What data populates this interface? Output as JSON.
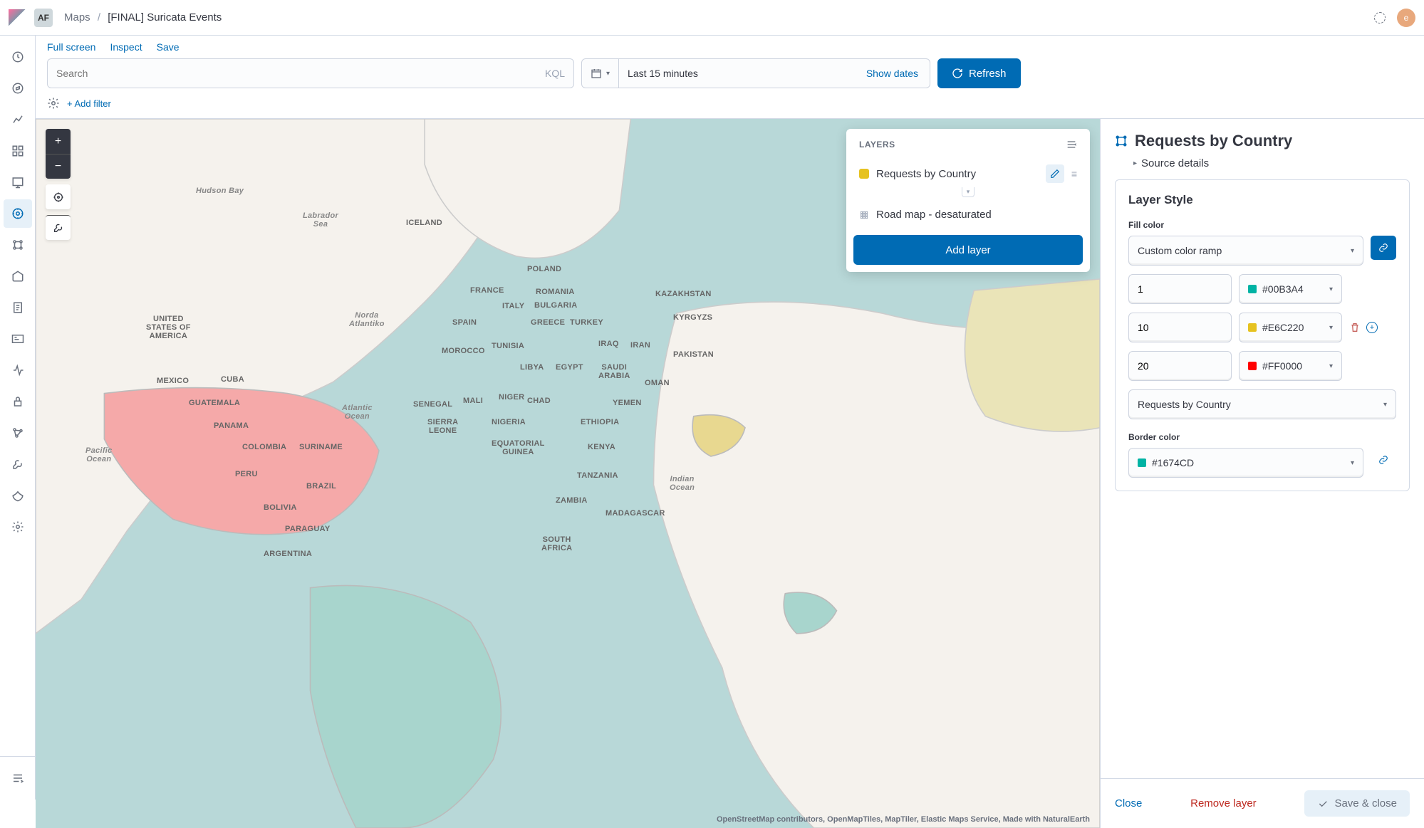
{
  "topbar": {
    "space": "AF",
    "breadcrumb_app": "Maps",
    "breadcrumb_title": "[FINAL] Suricata Events",
    "avatar": "e"
  },
  "actions": {
    "fullscreen": "Full screen",
    "inspect": "Inspect",
    "save": "Save"
  },
  "search": {
    "placeholder": "Search",
    "kql": "KQL",
    "daterange": "Last 15 minutes",
    "show_dates": "Show dates",
    "refresh": "Refresh"
  },
  "filter": {
    "add": "+ Add filter"
  },
  "layers": {
    "title": "LAYERS",
    "items": [
      {
        "name": "Requests by Country"
      },
      {
        "name": "Road map - desaturated"
      }
    ],
    "add_layer": "Add layer"
  },
  "map": {
    "attribution": "OpenStreetMap contributors, OpenMapTiles, MapTiler, Elastic Maps Service, Made with NaturalEarth",
    "labels": {
      "iceland": "ICELAND",
      "usa": "UNITED\nSTATES OF\nAMERICA",
      "mexico": "MEXICO",
      "cuba": "CUBA",
      "guatemala": "GUATEMALA",
      "panama": "PANAMA",
      "colombia": "COLOMBIA",
      "peru": "PERU",
      "bolivia": "BOLIVIA",
      "brazil": "BRAZIL",
      "paraguay": "PARAGUAY",
      "argentina": "ARGENTINA",
      "suriname": "SURINAME",
      "pacific": "Pacific\nOcean",
      "atlantic": "Atlantic\nOcean",
      "hudson": "Hudson Bay",
      "labrador": "Labrador\nSea",
      "norda": "Norda\nAtlantiko",
      "france": "FRANCE",
      "spain": "SPAIN",
      "italy": "ITALY",
      "greece": "GREECE",
      "turkey": "TURKEY",
      "romania": "ROMANIA",
      "bulgaria": "BULGARIA",
      "poland": "POLAND",
      "morocco": "MOROCCO",
      "tunisia": "TUNISIA",
      "libya": "LIBYA",
      "egypt": "EGYPT",
      "saudi": "SAUDI\nARABIA",
      "iraq": "IRAQ",
      "iran": "IRAN",
      "pakistan": "PAKISTAN",
      "kazakhstan": "KAZAKHSTAN",
      "kyrgyzstan": "KYRGYZS",
      "oman": "OMAN",
      "yemen": "YEMEN",
      "senegal": "SENEGAL",
      "sierra": "SIERRA\nLEONE",
      "mali": "MALI",
      "niger": "NIGER",
      "chad": "CHAD",
      "nigeria": "NIGERIA",
      "ethiopia": "ETHIOPIA",
      "kenya": "KENYA",
      "tanzania": "TANZANIA",
      "zambia": "ZAMBIA",
      "madagascar": "MADAGASCAR",
      "south_africa": "SOUTH\nAFRICA",
      "eq_guinea": "EQUATORIAL\nGUINEA",
      "indian": "Indian\nOcean"
    }
  },
  "settings": {
    "title": "Requests by Country",
    "source_details": "Source details",
    "style_title": "Layer Style",
    "fill_label": "Fill color",
    "ramp_mode": "Custom color ramp",
    "stops": [
      {
        "value": "1",
        "hex": "#00B3A4",
        "color": "#00b3a4"
      },
      {
        "value": "10",
        "hex": "#E6C220",
        "color": "#e6c220"
      },
      {
        "value": "20",
        "hex": "#FF0000",
        "color": "#ff0000"
      }
    ],
    "field_select": "Requests by Country",
    "border_label": "Border color",
    "border_hex": "#1674CD",
    "border_color": "#00b3a4"
  },
  "footer": {
    "close": "Close",
    "remove": "Remove layer",
    "save_close": "Save & close"
  }
}
